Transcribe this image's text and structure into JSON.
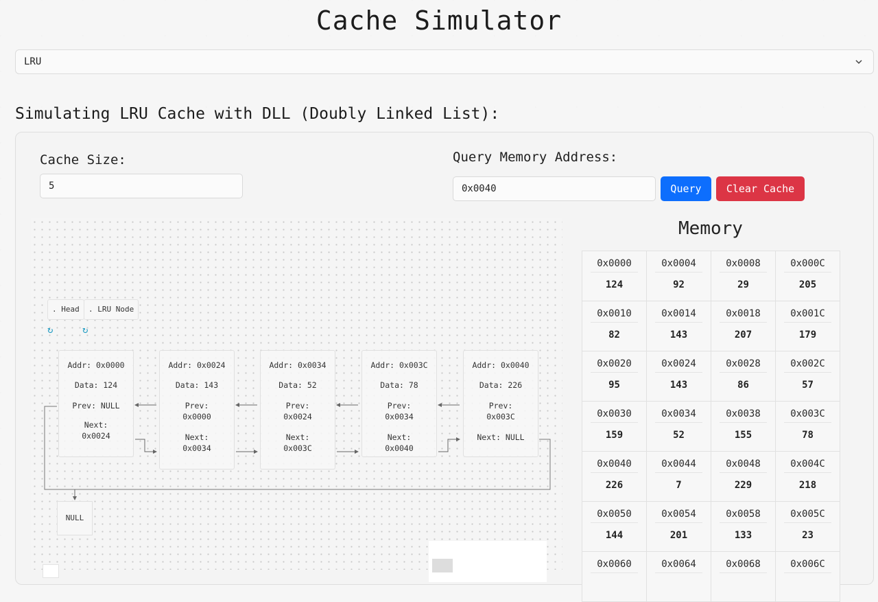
{
  "title": "Cache Simulator",
  "policy_select": {
    "value": "LRU"
  },
  "subtitle": "Simulating LRU Cache with DLL (Doubly Linked List):",
  "cache_size": {
    "label": "Cache Size:",
    "value": "5"
  },
  "query": {
    "label": "Query Memory Address:",
    "value": "0x0040",
    "query_button": "Query",
    "clear_button": "Clear Cache"
  },
  "diagram": {
    "head_tag": ". Head",
    "lru_tag": ". LRU Node",
    "hook_glyph": "↻",
    "null_label": "NULL",
    "nodes": [
      {
        "addr": "Addr: 0x0000",
        "data": "Data: 124",
        "prev": [
          "Prev: NULL"
        ],
        "next": [
          "Next:",
          "0x0024"
        ]
      },
      {
        "addr": "Addr: 0x0024",
        "data": "Data: 143",
        "prev": [
          "Prev:",
          "0x0000"
        ],
        "next": [
          "Next:",
          "0x0034"
        ]
      },
      {
        "addr": "Addr: 0x0034",
        "data": "Data: 52",
        "prev": [
          "Prev:",
          "0x0024"
        ],
        "next": [
          "Next:",
          "0x003C"
        ]
      },
      {
        "addr": "Addr: 0x003C",
        "data": "Data: 78",
        "prev": [
          "Prev:",
          "0x0034"
        ],
        "next": [
          "Next:",
          "0x0040"
        ]
      },
      {
        "addr": "Addr: 0x0040",
        "data": "Data: 226",
        "prev": [
          "Prev:",
          "0x003C"
        ],
        "next": [
          "Next: NULL"
        ]
      }
    ]
  },
  "memory": {
    "title": "Memory",
    "cells": [
      {
        "addr": "0x0000",
        "value": "124"
      },
      {
        "addr": "0x0004",
        "value": "92"
      },
      {
        "addr": "0x0008",
        "value": "29"
      },
      {
        "addr": "0x000C",
        "value": "205"
      },
      {
        "addr": "0x0010",
        "value": "82"
      },
      {
        "addr": "0x0014",
        "value": "143"
      },
      {
        "addr": "0x0018",
        "value": "207"
      },
      {
        "addr": "0x001C",
        "value": "179"
      },
      {
        "addr": "0x0020",
        "value": "95"
      },
      {
        "addr": "0x0024",
        "value": "143"
      },
      {
        "addr": "0x0028",
        "value": "86"
      },
      {
        "addr": "0x002C",
        "value": "57"
      },
      {
        "addr": "0x0030",
        "value": "159"
      },
      {
        "addr": "0x0034",
        "value": "52"
      },
      {
        "addr": "0x0038",
        "value": "155"
      },
      {
        "addr": "0x003C",
        "value": "78"
      },
      {
        "addr": "0x0040",
        "value": "226"
      },
      {
        "addr": "0x0044",
        "value": "7"
      },
      {
        "addr": "0x0048",
        "value": "229"
      },
      {
        "addr": "0x004C",
        "value": "218"
      },
      {
        "addr": "0x0050",
        "value": "144"
      },
      {
        "addr": "0x0054",
        "value": "201"
      },
      {
        "addr": "0x0058",
        "value": "133"
      },
      {
        "addr": "0x005C",
        "value": "23"
      },
      {
        "addr": "0x0060",
        "value": ""
      },
      {
        "addr": "0x0064",
        "value": ""
      },
      {
        "addr": "0x0068",
        "value": ""
      },
      {
        "addr": "0x006C",
        "value": ""
      }
    ]
  },
  "colors": {
    "query_button": "#0d6efd",
    "clear_button": "#dc3545",
    "pointer_hook": "#1f9bc2"
  }
}
